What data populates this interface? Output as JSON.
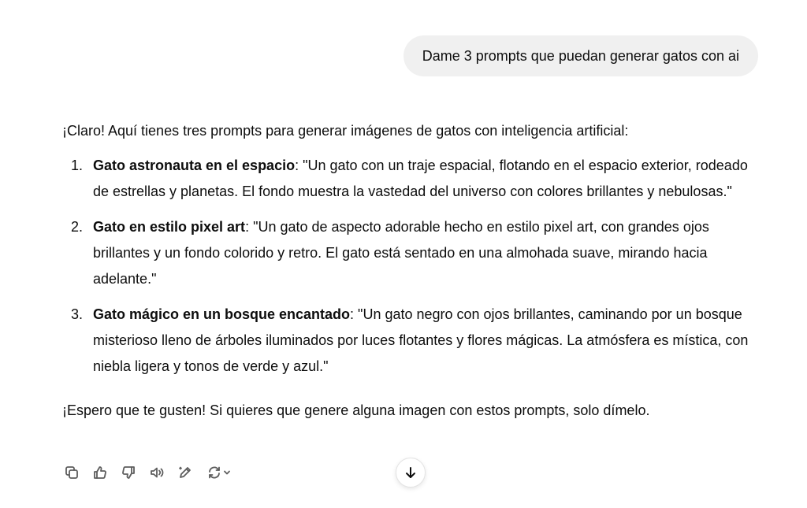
{
  "user_message": {
    "text": "Dame 3 prompts que puedan generar gatos con ai"
  },
  "assistant_message": {
    "intro": "¡Claro! Aquí tienes tres prompts para generar imágenes de gatos con inteligencia artificial:",
    "items": [
      {
        "number": "1.",
        "title": "Gato astronauta en el espacio",
        "body": ": \"Un gato con un traje espacial, flotando en el espacio exterior, rodeado de estrellas y planetas. El fondo muestra la vastedad del universo con colores brillantes y nebulosas.\""
      },
      {
        "number": "2.",
        "title": "Gato en estilo pixel art",
        "body": ": \"Un gato de aspecto adorable hecho en estilo pixel art, con grandes ojos brillantes y un fondo colorido y retro. El gato está sentado en una almohada suave, mirando hacia adelante.\""
      },
      {
        "number": "3.",
        "title": "Gato mágico en un bosque encantado",
        "body": ": \"Un gato negro con ojos brillantes, caminando por un bosque misterioso lleno de árboles iluminados por luces flotantes y flores mágicas. La atmósfera es mística, con niebla ligera y tonos de verde y azul.\""
      }
    ],
    "outro": "¡Espero que te gusten! Si quieres que genere alguna imagen con estos prompts, solo dímelo."
  },
  "toolbar": {
    "icons": [
      "copy-icon",
      "thumbs-up-icon",
      "thumbs-down-icon",
      "read-aloud-icon",
      "edit-icon",
      "regenerate-icon",
      "chevron-down-icon"
    ]
  },
  "scroll_button": {
    "icon": "arrow-down-icon"
  },
  "colors": {
    "user_bubble_bg": "#f0f0f0",
    "text": "#0d0d0d",
    "icon": "#5d5d5d"
  }
}
